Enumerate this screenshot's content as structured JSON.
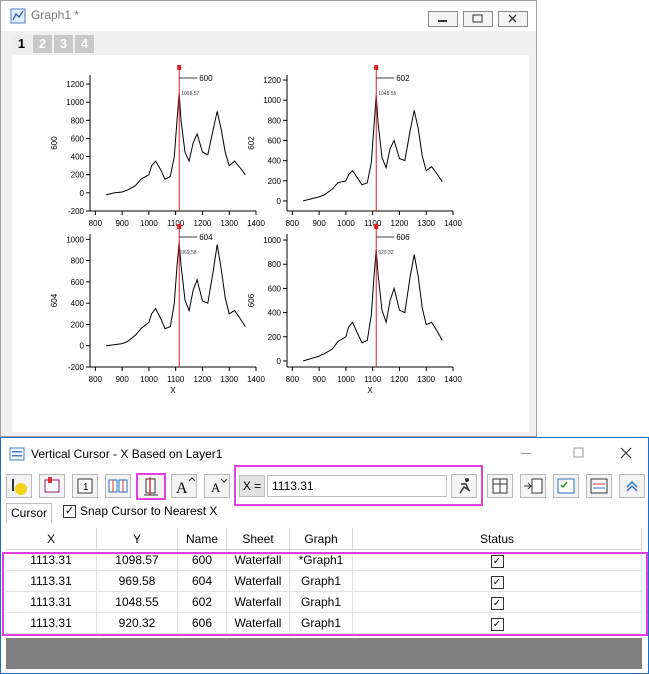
{
  "graph_window": {
    "title": "Graph1 *",
    "layer_tabs": [
      "1",
      "2",
      "3",
      "4"
    ],
    "active_layer": "1"
  },
  "chart_data": [
    {
      "type": "line",
      "title": "",
      "xlabel": "",
      "ylabel": "600",
      "xlim": [
        780,
        1400
      ],
      "ylim": [
        -200,
        1300
      ],
      "xticks": [
        800,
        900,
        1000,
        1100,
        1200,
        1300,
        1400
      ],
      "yticks": [
        -200,
        0,
        200,
        400,
        600,
        800,
        1000,
        1200
      ],
      "cursor_x": 1113.31,
      "cursor_label": "600",
      "cursor_value_label": "1098.57",
      "x": [
        840,
        870,
        900,
        920,
        950,
        970,
        1000,
        1010,
        1025,
        1045,
        1060,
        1080,
        1095,
        1105,
        1113,
        1120,
        1135,
        1150,
        1165,
        1180,
        1200,
        1220,
        1240,
        1255,
        1270,
        1285,
        1300,
        1320,
        1340,
        1360
      ],
      "y": [
        -20,
        0,
        10,
        30,
        80,
        150,
        200,
        300,
        350,
        250,
        150,
        180,
        400,
        800,
        1098,
        800,
        450,
        350,
        550,
        650,
        450,
        420,
        700,
        900,
        700,
        450,
        300,
        350,
        280,
        200
      ]
    },
    {
      "type": "line",
      "title": "",
      "xlabel": "",
      "ylabel": "602",
      "xlim": [
        780,
        1400
      ],
      "ylim": [
        -100,
        1250
      ],
      "xticks": [
        800,
        900,
        1000,
        1100,
        1200,
        1300,
        1400
      ],
      "yticks": [
        0,
        200,
        400,
        600,
        800,
        1000,
        1200
      ],
      "cursor_x": 1113.31,
      "cursor_label": "602",
      "cursor_value_label": "1048.55",
      "x": [
        840,
        870,
        900,
        920,
        950,
        970,
        1000,
        1010,
        1025,
        1045,
        1060,
        1080,
        1095,
        1105,
        1113,
        1120,
        1135,
        1150,
        1165,
        1180,
        1200,
        1220,
        1240,
        1255,
        1270,
        1285,
        1300,
        1320,
        1340,
        1360
      ],
      "y": [
        0,
        20,
        40,
        60,
        120,
        180,
        200,
        260,
        300,
        220,
        160,
        180,
        380,
        750,
        1048,
        780,
        430,
        330,
        520,
        600,
        420,
        400,
        700,
        900,
        720,
        450,
        300,
        340,
        270,
        190
      ]
    },
    {
      "type": "line",
      "title": "",
      "xlabel": "X",
      "ylabel": "604",
      "xlim": [
        780,
        1400
      ],
      "ylim": [
        -200,
        1050
      ],
      "xticks": [
        800,
        900,
        1000,
        1100,
        1200,
        1300,
        1400
      ],
      "yticks": [
        -200,
        0,
        200,
        400,
        600,
        800,
        1000
      ],
      "cursor_x": 1113.31,
      "cursor_label": "604",
      "cursor_value_label": "969.58",
      "x": [
        840,
        870,
        900,
        920,
        950,
        970,
        1000,
        1010,
        1025,
        1045,
        1060,
        1080,
        1095,
        1105,
        1113,
        1120,
        1135,
        1150,
        1165,
        1180,
        1200,
        1220,
        1240,
        1255,
        1270,
        1285,
        1300,
        1320,
        1340,
        1360
      ],
      "y": [
        0,
        10,
        20,
        40,
        100,
        160,
        220,
        300,
        350,
        250,
        160,
        180,
        400,
        750,
        969,
        760,
        430,
        330,
        520,
        620,
        420,
        400,
        700,
        950,
        720,
        450,
        300,
        330,
        260,
        180
      ]
    },
    {
      "type": "line",
      "title": "",
      "xlabel": "X",
      "ylabel": "606",
      "xlim": [
        780,
        1400
      ],
      "ylim": [
        -50,
        1050
      ],
      "xticks": [
        800,
        900,
        1000,
        1100,
        1200,
        1300,
        1400
      ],
      "yticks": [
        0,
        200,
        400,
        600,
        800,
        1000
      ],
      "cursor_x": 1113.31,
      "cursor_label": "606",
      "cursor_value_label": "920.32",
      "x": [
        840,
        870,
        900,
        920,
        950,
        970,
        1000,
        1010,
        1025,
        1045,
        1060,
        1080,
        1095,
        1105,
        1113,
        1120,
        1135,
        1150,
        1165,
        1180,
        1200,
        1220,
        1240,
        1255,
        1270,
        1285,
        1300,
        1320,
        1340,
        1360
      ],
      "y": [
        0,
        20,
        40,
        60,
        100,
        160,
        200,
        280,
        320,
        220,
        150,
        170,
        380,
        700,
        920,
        720,
        420,
        320,
        500,
        600,
        420,
        400,
        700,
        880,
        700,
        440,
        300,
        320,
        250,
        170
      ]
    }
  ],
  "cursor_window": {
    "title": "Vertical Cursor - X Based on Layer1",
    "x_label": "X =",
    "x_value": "1113.31",
    "tab_label": "Cursor",
    "snap_label": "Snap Cursor to Nearest X",
    "snap_checked": true,
    "columns": [
      "X",
      "Y",
      "Name",
      "Sheet",
      "Graph",
      "Status"
    ],
    "rows": [
      {
        "x": "1113.31",
        "y": "1098.57",
        "name": "600",
        "sheet": "Waterfall",
        "graph": "*Graph1",
        "status": "✓"
      },
      {
        "x": "1113.31",
        "y": "969.58",
        "name": "604",
        "sheet": "Waterfall",
        "graph": "Graph1",
        "status": "✓"
      },
      {
        "x": "1113.31",
        "y": "1048.55",
        "name": "602",
        "sheet": "Waterfall",
        "graph": "Graph1",
        "status": "✓"
      },
      {
        "x": "1113.31",
        "y": "920.32",
        "name": "606",
        "sheet": "Waterfall",
        "graph": "Graph1",
        "status": "✓"
      }
    ]
  },
  "colors": {
    "cursor_line": "#e02020",
    "highlight": "#e53ee5",
    "data_line": "#000000"
  }
}
